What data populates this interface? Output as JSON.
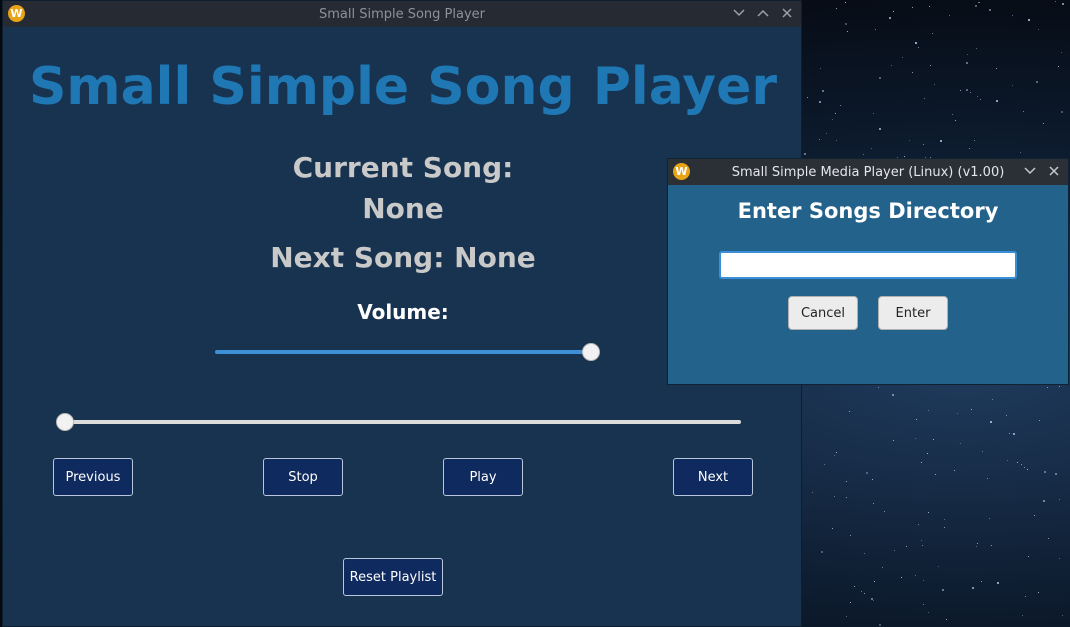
{
  "main_window": {
    "title": "Small Simple Song Player",
    "heading": "Small Simple Song Player",
    "current_song_label": "Current Song:",
    "current_song_value": "None",
    "next_song_text": "Next Song: None",
    "volume_label": "Volume:",
    "volume_level": 1.0,
    "seek_position": 0.0,
    "buttons": {
      "previous": "Previous",
      "stop": "Stop",
      "play": "Play",
      "next": "Next",
      "reset_playlist": "Reset Playlist"
    }
  },
  "dialog": {
    "title": "Small Simple Media Player (Linux) (v1.00)",
    "heading": "Enter Songs Directory",
    "input_value": "",
    "cancel_label": "Cancel",
    "enter_label": "Enter"
  },
  "icons": {
    "app_icon": "W",
    "minimize": "chevron-down-icon",
    "maximize": "chevron-up-icon",
    "close": "close-icon"
  },
  "colors": {
    "heading_blue": "#1f77b4",
    "main_bg": "#17334f",
    "button_bg": "#0f2a5e",
    "dialog_bg": "#23628a",
    "volume_fill": "#3d8fd6"
  }
}
